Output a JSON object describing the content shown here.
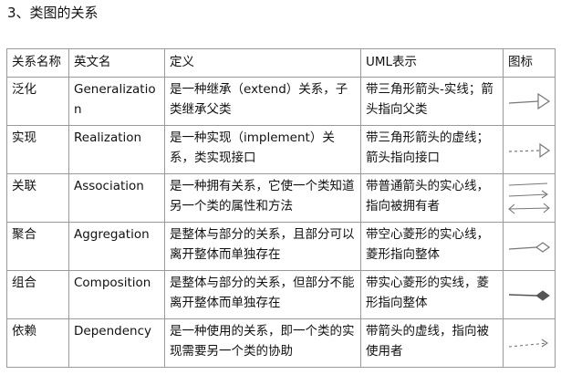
{
  "heading": "3、类图的关系",
  "table": {
    "headers": [
      "关系名称",
      "英文名",
      "定义",
      "UML表示",
      "图标"
    ],
    "rows": [
      {
        "name": "泛化",
        "english": "Generalization",
        "definition": "是一种继承（extend）关系，子类继承父类",
        "uml": "带三角形箭头-实线；箭头指向父类",
        "icon": "solid-line-hollow-triangle-icon"
      },
      {
        "name": "实现",
        "english": "Realization",
        "definition": "是一种实现（implement）关系，类实现接口",
        "uml": "带三角形箭头的虚线；箭头指向接口",
        "icon": "dashed-line-hollow-triangle-icon"
      },
      {
        "name": "关联",
        "english": "Association",
        "definition": "是一种拥有关系，它使一个类知道另一个类的属性和方法",
        "uml": "带普通箭头的实心线，指向被拥有者",
        "icon": "association-arrows-icon"
      },
      {
        "name": "聚合",
        "english": "Aggregation",
        "definition": "是整体与部分的关系，且部分可以离开整体而单独存在",
        "uml": "带空心菱形的实心线，菱形指向整体",
        "icon": "hollow-diamond-line-icon"
      },
      {
        "name": "组合",
        "english": "Composition",
        "definition": "是整体与部分的关系，但部分不能离开整体而单独存在",
        "uml": "带实心菱形的实线，菱形指向整体",
        "icon": "filled-diamond-line-icon"
      },
      {
        "name": "依赖",
        "english": "Dependency",
        "definition": "是一种使用的关系，即一个类的实现需要另一个类的协助",
        "uml": "带箭头的虚线，指向被使用者",
        "icon": "dashed-open-arrow-icon"
      }
    ]
  },
  "colors": {
    "border": "#9a9a9a",
    "icon_stroke": "#777777"
  }
}
